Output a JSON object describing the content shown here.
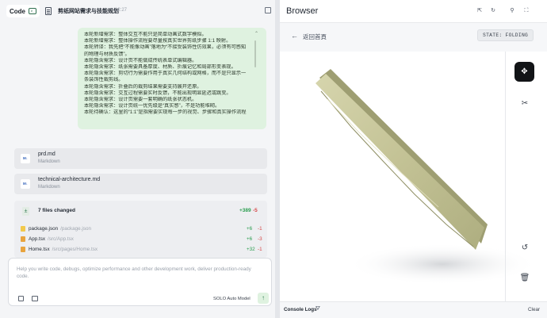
{
  "left_panel": {
    "tab_label": "Code",
    "project_title": "剪纸网站需求与技能规划",
    "time": "12:27",
    "message_lines": [
      "本轮新增需求：整体交互不能只是简单动画式数字模拟。",
      "本轮新增需求：整体操作流程要尽量按真实世界剪纸步骤 1:1 映射。",
      "本轮转译：我先把“不能像动画”落地为“不接受装饰性仿效果，必须有可感知",
      "的物理与材质反馈”。",
      "本轮隐含需求：设计页不能做成传统表单式编辑器。",
      "本轮隐含需求：纸张需要具备厚度、材质、折痕记忆和局部形变表现。",
      "本轮隐含需求：剪切行为需要作用于真实几何结构或网格，而不是只显示一",
      "条装饰性裁剪线。",
      "本轮隐含需求：折叠后的裁剪结果需要支持展开还原。",
      "本轮隐含需求：交互过程需要实时反馈，不能出现明显延迟或跳变。",
      "本轮隐含需求：设计页需要一套明确的纸张状态机。",
      "本轮隐含需求：设计页统一优先级是“真实感”，不是功能堆砌。",
      "本轮待确认：这里的“1:1”是指需要实现每一步的视觉、步骤和真实操作流程"
    ],
    "files": [
      {
        "name": "prd.md",
        "type": "Markdown",
        "icon": "M↓"
      },
      {
        "name": "technical-architecture.md",
        "type": "Markdown",
        "icon": "M↓"
      }
    ],
    "changes": {
      "title": "7 files changed",
      "additions": "+389",
      "deletions": "-5",
      "rows": [
        {
          "name": "package.json",
          "path": "/package.json",
          "add": "+6",
          "del": "-1"
        },
        {
          "name": "App.tsx",
          "path": "/src/App.tsx",
          "add": "+6",
          "del": "-3"
        },
        {
          "name": "Home.tsx",
          "path": "/src/pages/Home.tsx",
          "add": "+32",
          "del": "-1"
        }
      ]
    },
    "input": {
      "placeholder": "Help you write code, debugs, optimize performance and other development work, deliver production-ready code.",
      "model": "SOLO Auto Model"
    }
  },
  "browser": {
    "title": "Browser",
    "back_text": "返回首頁",
    "state_badge": "STATE: FOLDING",
    "console_label": "Console Logs",
    "clear_label": "Clear"
  },
  "colors": {
    "accent_green": "#2a9d4f",
    "delete_red": "#d64545",
    "message_bg": "#dff2e0",
    "paper": "#c8c79a"
  }
}
